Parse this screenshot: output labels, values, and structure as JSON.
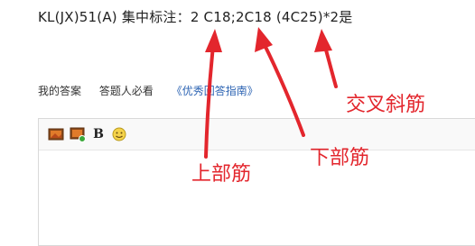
{
  "question": {
    "text": "KL(JX)51(A)  集中标注：2 C18;2C18   (4C25)*2是"
  },
  "tabs": {
    "my_answer": "我的答案",
    "must_read": "答题人必看",
    "guide_link": "《优秀回答指南》"
  },
  "toolbar": {
    "bold_label": "B",
    "icons": [
      "image-icon",
      "image-upload-icon",
      "bold-icon",
      "emoji-icon"
    ]
  },
  "annotations": {
    "top_bars": "上部筋",
    "bottom_bars": "下部筋",
    "cross_bars": "交叉斜筋"
  },
  "colors": {
    "annotation": "#e3262d",
    "link": "#2d64b3"
  }
}
